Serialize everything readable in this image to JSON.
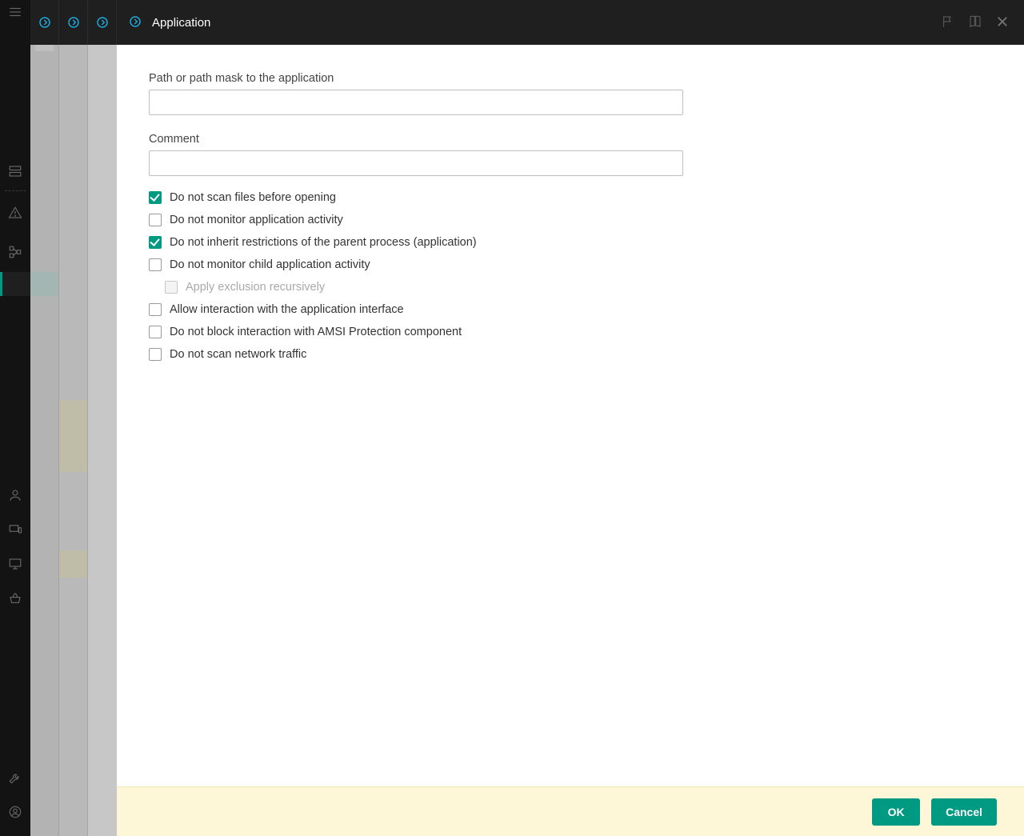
{
  "header": {
    "title": "Application"
  },
  "form": {
    "path_label": "Path or path mask to the application",
    "path_value": "",
    "comment_label": "Comment",
    "comment_value": ""
  },
  "checkboxes": [
    {
      "key": "no_scan_before_open",
      "label": "Do not scan files before opening",
      "checked": true,
      "disabled": false,
      "indent": false
    },
    {
      "key": "no_monitor_activity",
      "label": "Do not monitor application activity",
      "checked": false,
      "disabled": false,
      "indent": false
    },
    {
      "key": "no_inherit_parent",
      "label": "Do not inherit restrictions of the parent process (application)",
      "checked": true,
      "disabled": false,
      "indent": false
    },
    {
      "key": "no_monitor_child",
      "label": "Do not monitor child application activity",
      "checked": false,
      "disabled": false,
      "indent": false
    },
    {
      "key": "apply_recursively",
      "label": "Apply exclusion recursively",
      "checked": false,
      "disabled": true,
      "indent": true
    },
    {
      "key": "allow_interaction",
      "label": "Allow interaction with the application interface",
      "checked": false,
      "disabled": false,
      "indent": false
    },
    {
      "key": "no_block_amsi",
      "label": "Do not block interaction with AMSI Protection component",
      "checked": false,
      "disabled": false,
      "indent": false
    },
    {
      "key": "no_scan_network",
      "label": "Do not scan network traffic",
      "checked": false,
      "disabled": false,
      "indent": false
    }
  ],
  "footer": {
    "ok_label": "OK",
    "cancel_label": "Cancel"
  },
  "colors": {
    "accent": "#009982",
    "crumb_icon": "#1fa8d8",
    "footer_bg": "#fdf7d7"
  }
}
